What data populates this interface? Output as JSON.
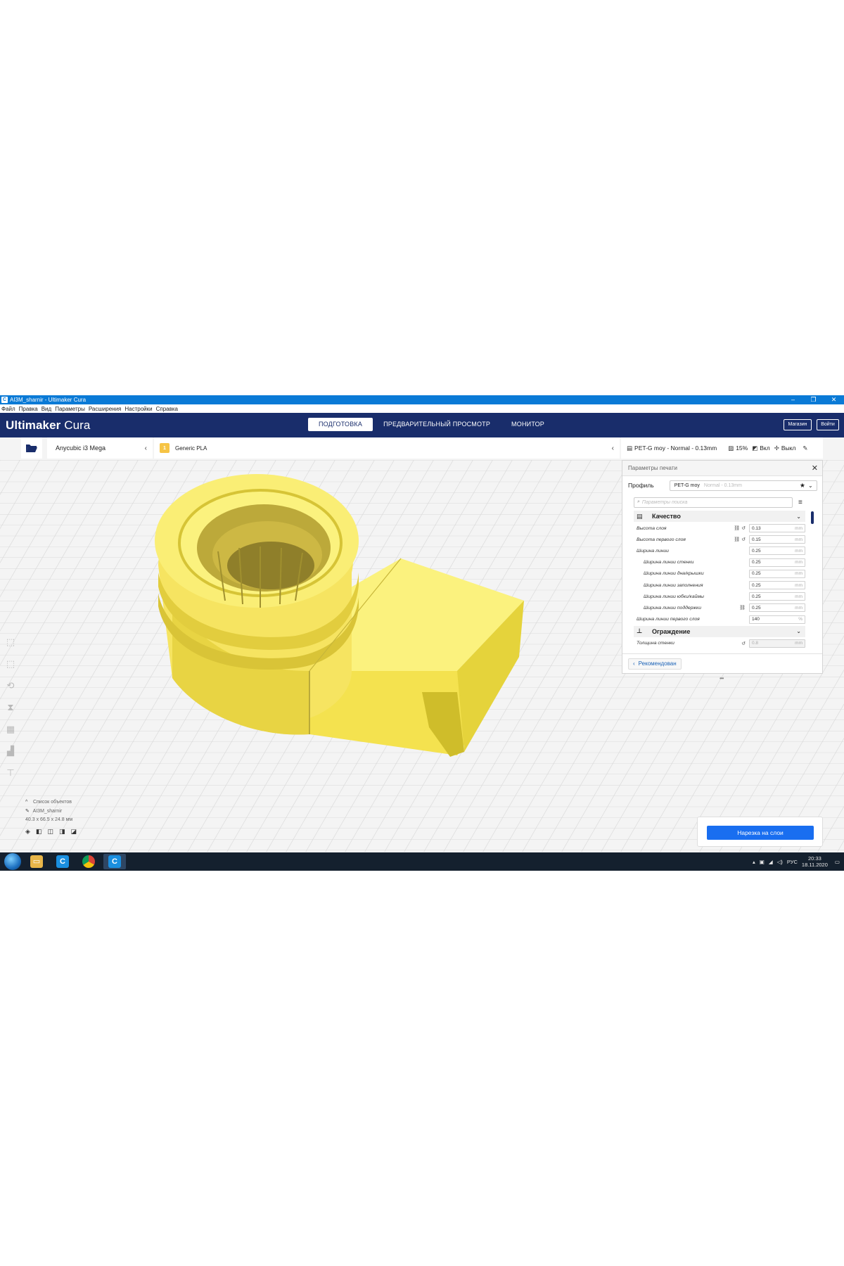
{
  "window": {
    "title": "AI3M_sharnir - Ultimaker Cura",
    "controls": [
      "–",
      "❐",
      "✕"
    ]
  },
  "menu": [
    "Файл",
    "Правка",
    "Вид",
    "Параметры",
    "Расширения",
    "Настройки",
    "Справка"
  ],
  "header": {
    "logo_bold": "Ultimaker",
    "logo_light": "Cura",
    "stages": [
      "ПОДГОТОВКА",
      "ПРЕДВАРИТЕЛЬНЫЙ ПРОСМОТР",
      "МОНИТОР"
    ],
    "shop_button": "Магазин",
    "login_button": "Войти"
  },
  "toolbar": {
    "machine": "Anycubic i3 Mega",
    "material": "Generic PLA",
    "profile_summary": "PET-G moy - Normal - 0.13mm",
    "infill": "15%",
    "support": "Вкл",
    "adhesion": "Выкл"
  },
  "panel": {
    "title": "Параметры печати",
    "profile_label": "Профиль",
    "profile_value": "PET-G moy",
    "profile_hint": "Normal - 0.13mm",
    "search_placeholder": "Параметры поиска",
    "categories": {
      "quality": "Качество",
      "walls": "Ограждение"
    },
    "settings": [
      {
        "label": "Высота слоя",
        "value": "0.13",
        "unit": "mm",
        "indent": false
      },
      {
        "label": "Высота первого слоя",
        "value": "0.15",
        "unit": "mm",
        "indent": false
      },
      {
        "label": "Ширина линии",
        "value": "0.25",
        "unit": "mm",
        "indent": false
      },
      {
        "label": "Ширина линии стенки",
        "value": "0.25",
        "unit": "mm",
        "indent": true
      },
      {
        "label": "Ширина линии дна/крышки",
        "value": "0.25",
        "unit": "mm",
        "indent": true
      },
      {
        "label": "Ширина линии заполнения",
        "value": "0.25",
        "unit": "mm",
        "indent": true
      },
      {
        "label": "Ширина линии юбки/каймы",
        "value": "0.25",
        "unit": "mm",
        "indent": true
      },
      {
        "label": "Ширина линии поддержки",
        "value": "0.25",
        "unit": "mm",
        "indent": true
      },
      {
        "label": "Ширина линии первого слоя",
        "value": "140",
        "unit": "%",
        "indent": false
      }
    ],
    "wall_setting": {
      "label": "Толщина стенки",
      "value": "0.8",
      "unit": "mm"
    },
    "recommended_button": "Рекомендован"
  },
  "objects": {
    "list_label": "Список объектов",
    "object_name": "AI3M_sharnir",
    "dimensions": "40.3 x 66.5 x 24.8 мм"
  },
  "slice_button": "Нарезка на слои",
  "taskbar": {
    "language": "РУС",
    "time": "20:33",
    "date": "18.11.2020"
  },
  "colors": {
    "header_bg": "#192d6b",
    "titlebar_bg": "#0a7ad6",
    "model_yellow": "#f7e76a",
    "slice_blue": "#196ef0",
    "taskbar_bg": "#14202e"
  }
}
